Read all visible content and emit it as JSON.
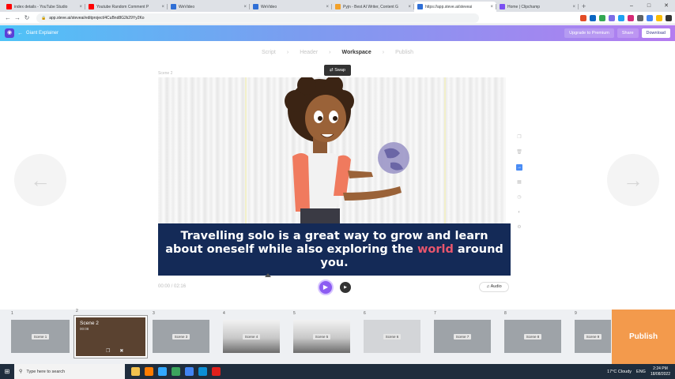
{
  "browser": {
    "tabs": [
      {
        "title": "index details - YouTube Studio",
        "color": "#ff0000",
        "active": false
      },
      {
        "title": "Youtube Random Comment P",
        "color": "#ff0000",
        "active": false
      },
      {
        "title": "WeVideo",
        "color": "#2f6fd6",
        "active": false
      },
      {
        "title": "WeVideo",
        "color": "#2f6fd6",
        "active": false
      },
      {
        "title": "Pyjn - Best AI Writer, Content G",
        "color": "#f2a12a",
        "active": false
      },
      {
        "title": "https://app.steve.ai/steveai",
        "color": "#2f6fd6",
        "active": true
      },
      {
        "title": "Home | Clipchamp",
        "color": "#7b4ff2",
        "active": false
      }
    ],
    "url": "app.steve.ai/steveai/editproject/4CuBnd8G2k29Yy2Ko",
    "window_controls": [
      "–",
      "□",
      "✕"
    ],
    "new_tab": "+",
    "ext_colors": [
      "#e34c26",
      "#0a66c2",
      "#34a853",
      "#7d6ee7",
      "#1da1f2",
      "#d62976",
      "#5f6368",
      "#4285f4",
      "#fbbc05",
      "#333333"
    ]
  },
  "app": {
    "project_name": "Giant Explainer",
    "upgrade": "Upgrade to Premium",
    "share": "Share",
    "download": "Download"
  },
  "steps": [
    "Script",
    "Header",
    "Workspace",
    "Publish"
  ],
  "stage": {
    "scene_label": "Scene 2",
    "swap": "Swap",
    "caption_before": "Travelling solo is a great way to grow and learn about oneself while also exploring the ",
    "caption_highlight": "world",
    "caption_after": " around you.",
    "timecode": "00:00 / 02:16",
    "audio": "Audio"
  },
  "timeline": {
    "scenes": [
      {
        "num": "1",
        "label": "Scene 1",
        "style": "grey"
      },
      {
        "num": "2",
        "label": "Scene 2",
        "time": "00:08",
        "style": "active"
      },
      {
        "num": "3",
        "label": "Scene 3",
        "style": "grey"
      },
      {
        "num": "4",
        "label": "Scene 4",
        "style": "scene"
      },
      {
        "num": "5",
        "label": "Scene 5",
        "style": "scene"
      },
      {
        "num": "6",
        "label": "Scene 6",
        "style": "light"
      },
      {
        "num": "7",
        "label": "Scene 7",
        "style": "grey"
      },
      {
        "num": "8",
        "label": "Scene 8",
        "style": "grey"
      },
      {
        "num": "9",
        "label": "Scene 9",
        "style": "grey"
      }
    ],
    "publish": "Publish"
  },
  "taskbar": {
    "search_placeholder": "Type here to search",
    "weather": "17°C Cloudy",
    "lang": "ENG",
    "time": "2:24 PM",
    "date": "18/08/2022",
    "apps": [
      {
        "icon": "explorer-icon",
        "color": "#f2c14e"
      },
      {
        "icon": "illustrator-icon",
        "color": "#ff7c00"
      },
      {
        "icon": "photoshop-icon",
        "color": "#31a8ff"
      },
      {
        "icon": "app-icon-green",
        "color": "#3ba55d"
      },
      {
        "icon": "chrome-icon",
        "color": "#4285f4"
      },
      {
        "icon": "edge-icon",
        "color": "#0c8fd6"
      },
      {
        "icon": "opera-icon",
        "color": "#e0201c"
      }
    ]
  }
}
